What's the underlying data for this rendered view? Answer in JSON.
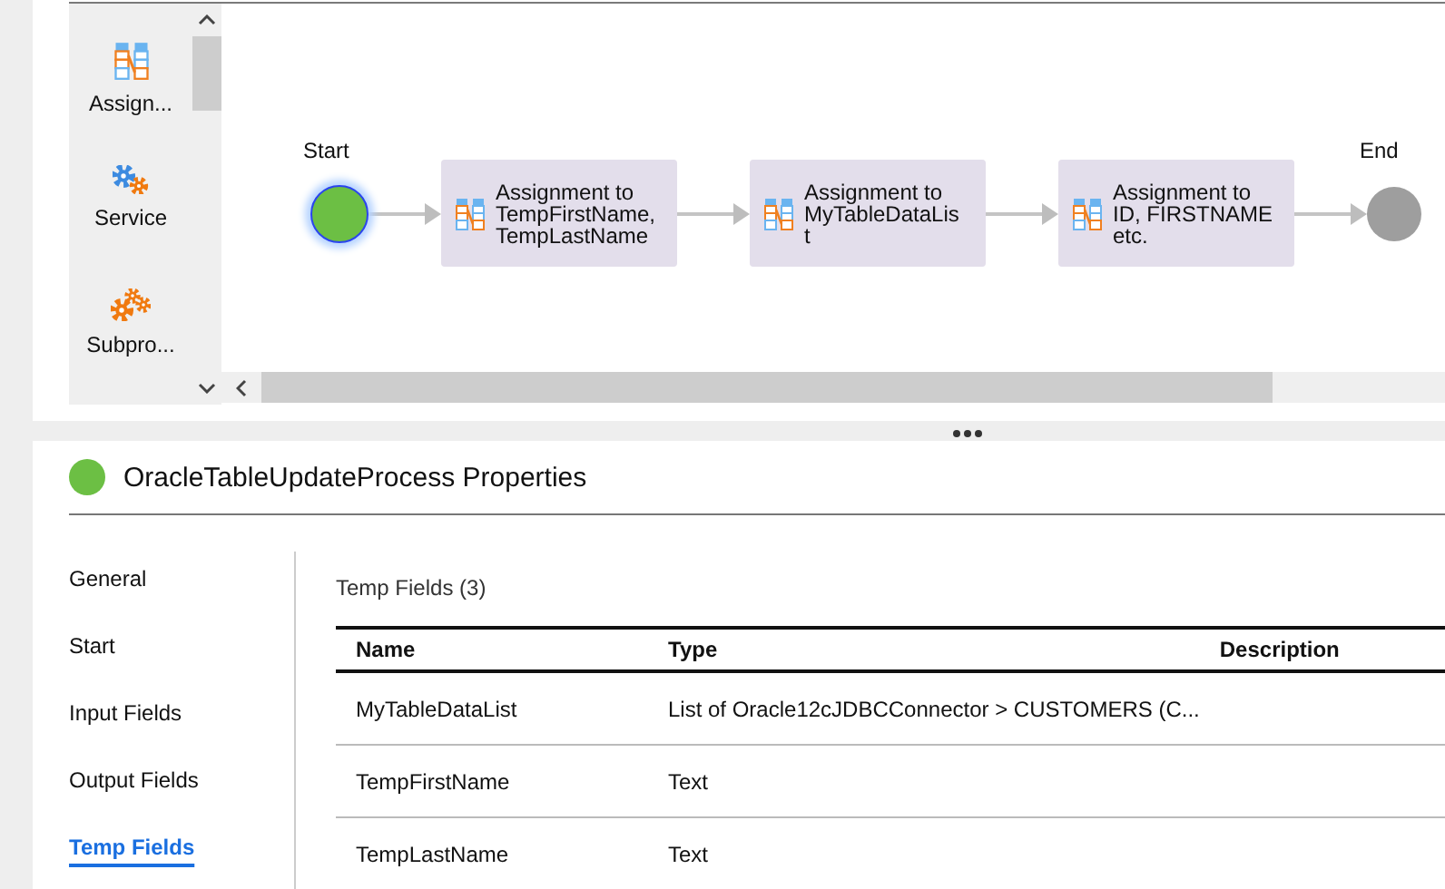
{
  "palette": {
    "items": [
      {
        "kind": "assignment",
        "label": "Assign..."
      },
      {
        "kind": "service",
        "label": "Service"
      },
      {
        "kind": "subprocess",
        "label": "Subpro..."
      }
    ]
  },
  "diagram": {
    "nodes": [
      {
        "kind": "start",
        "label": "Start",
        "selected": true
      },
      {
        "kind": "assignment",
        "label": "Assignment to\nTempFirstName,\nTempLastName",
        "selected": false
      },
      {
        "kind": "assignment",
        "label": "Assignment to\nMyTableDataLis\nt",
        "selected": false
      },
      {
        "kind": "assignment",
        "label": "Assignment to\nID, FIRSTNAME\netc.",
        "selected": false
      },
      {
        "kind": "end",
        "label": "End",
        "selected": false
      }
    ]
  },
  "properties": {
    "title": "OracleTableUpdateProcess Properties",
    "nav": [
      {
        "label": "General",
        "selected": false
      },
      {
        "label": "Start",
        "selected": false
      },
      {
        "label": "Input Fields",
        "selected": false
      },
      {
        "label": "Output Fields",
        "selected": false
      },
      {
        "label": "Temp Fields",
        "selected": true
      }
    ],
    "section_title": "Temp Fields (3)",
    "table": {
      "columns": [
        "Name",
        "Type",
        "Description"
      ],
      "rows": [
        {
          "name": "MyTableDataList",
          "type": "List of Oracle12cJDBCConnector > CUSTOMERS (C..."
        },
        {
          "name": "TempFirstName",
          "type": "Text"
        },
        {
          "name": "TempLastName",
          "type": "Text"
        }
      ]
    }
  }
}
